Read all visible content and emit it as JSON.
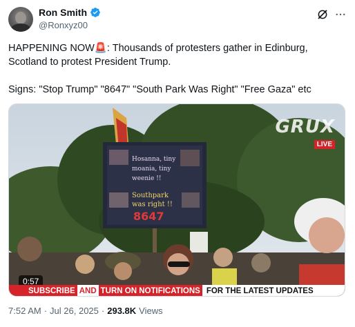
{
  "author": {
    "display_name": "Ron Smith",
    "handle": "@Ronxyz00",
    "verified": true
  },
  "actions": {
    "grok_icon": "grok-icon",
    "more_icon": "more-icon"
  },
  "tweet": {
    "line1": "HAPPENING NOW🚨: Thousands of protesters gather in Edinburg, Scotland to protest President Trump.",
    "line2": "Signs: \"Stop Trump\" \"8647\" \"South Park Was Right\" \"Free Gaza\" etc"
  },
  "media": {
    "type": "video",
    "duration": "0:57",
    "channel_brand": "GRUX",
    "live_badge": "LIVE",
    "sign_text": "Hosanna, tiny moania, tiny weenie !! Southpark was right !! 8647",
    "banner": {
      "part1": "SUBSCRIBE",
      "part2": "AND",
      "part3": "TURN ON NOTIFICATIONS",
      "part4": "FOR THE LATEST UPDATES"
    }
  },
  "meta": {
    "time": "7:52 AM",
    "separator1": "·",
    "date": "Jul 26, 2025",
    "separator2": "·",
    "views_count": "293.8K",
    "views_label": "Views"
  },
  "colors": {
    "verified_blue": "#1d9bf0",
    "secondary_text": "#536471",
    "banner_red": "#d6232a"
  }
}
